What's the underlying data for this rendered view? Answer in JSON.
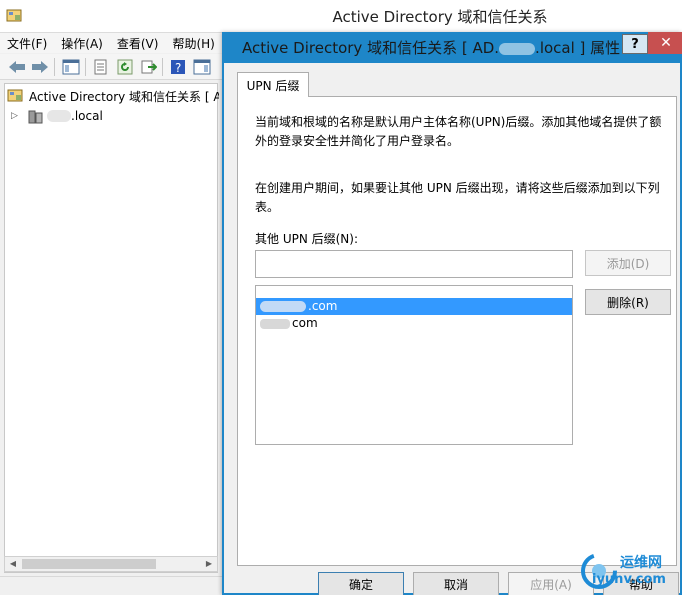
{
  "main_window": {
    "title": "Active Directory 域和信任关系",
    "menu": [
      "文件(F)",
      "操作(A)",
      "查看(V)",
      "帮助(H)"
    ],
    "tree": {
      "root_label": "Active Directory 域和信任关系 [ A",
      "child_label": ".local"
    }
  },
  "dialog": {
    "title_prefix": "Active Directory 域和信任关系 [ AD.",
    "title_suffix": ".local ] 属性",
    "help_label": "?",
    "close_label": "✕",
    "tab_label": "UPN 后缀",
    "desc1": "当前域和根域的名称是默认用户主体名称(UPN)后缀。添加其他域名提供了额外的登录安全性并简化了用户登录名。",
    "desc2": "在创建用户期间，如果要让其他 UPN 后缀出现，请将这些后缀添加到以下列表。",
    "field_label": "其他 UPN 后缀(N):",
    "input_value": "",
    "add_button": "添加(D)",
    "remove_button": "删除(R)",
    "list_items": [
      ".com",
      "com"
    ],
    "selected_index": 0,
    "ok_button": "确定",
    "cancel_button": "取消",
    "apply_button": "应用(A)",
    "help_button": "帮助"
  },
  "watermark": {
    "line1": "运维网",
    "line2": "iyunv.com"
  },
  "colors": {
    "dialog_accent": "#1e86c8",
    "close_red": "#c75050",
    "selection": "#3399ff"
  }
}
